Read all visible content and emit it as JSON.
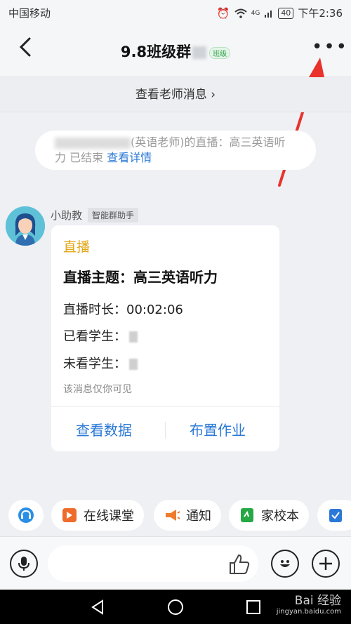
{
  "status_bar": {
    "carrier": "中国移动",
    "battery": "40",
    "time": "下午2:36",
    "network": "4G"
  },
  "header": {
    "title": "9.8班级群",
    "class_tag": "班级"
  },
  "teacher_link": "查看老师消息 ›",
  "notice": {
    "text": "(英语老师)的直播：高三英语听力 已结束",
    "link": "查看详情"
  },
  "message": {
    "sender": "小助教",
    "sender_tag": "智能群助手",
    "card": {
      "kind": "直播",
      "topic": "直播主题：高三英语听力",
      "duration_label": "直播时长：",
      "duration": "00:02:06",
      "watched_label": "已看学生：",
      "unwatched_label": "未看学生：",
      "note": "该消息仅你可见",
      "actions": [
        "查看数据",
        "布置作业"
      ]
    }
  },
  "shortcuts": [
    {
      "label": "在线课堂",
      "icon": "online-class-icon",
      "color": "#ef6b2c"
    },
    {
      "label": "通知",
      "icon": "megaphone-icon",
      "color": "#ef7b2c"
    },
    {
      "label": "家校本",
      "icon": "notebook-icon",
      "color": "#27a745"
    }
  ],
  "watermark": {
    "brand": "Bai 经验",
    "url": "jingyan.baidu.com"
  }
}
